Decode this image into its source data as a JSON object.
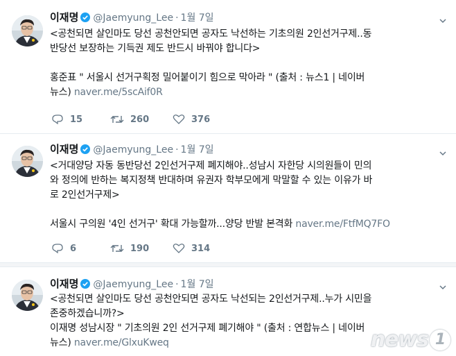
{
  "tweets": [
    {
      "name": "이재명",
      "handle": "@Jaemyung_Lee",
      "separator": "·",
      "date": "1월 7일",
      "lines": [
        "<공천되면 살인마도 당선 공천안되면 공자도 낙선하는 기초의원 2인선거구제..동",
        "반당선 보장하는 기득권 제도 반드시 바꿔야 합니다>"
      ],
      "quote_line1": "홍준표  \" 서울시 선거구획정 밀어붙이기 힘으로 막아라 \"  (출처 : 뉴스1 | 네이버",
      "quote_line2_text": "뉴스) ",
      "quote_link": "naver.me/5scAif0R",
      "replies": "15",
      "retweets": "260",
      "likes": "376"
    },
    {
      "name": "이재명",
      "handle": "@Jaemyung_Lee",
      "separator": "·",
      "date": "1월 7일",
      "lines": [
        "<거대양당 자동 동반당선 2인선거구제 폐지해야..성남시 자한당 시의원들이 민의",
        "와 정의에 반하는 복지정책 반대하며 유권자 학부모에게 막말할 수 있는 이유가 바",
        "로 2인선거구제>"
      ],
      "quote_text": "서울시 구의원 '4인 선거구' 확대 가능할까...양당 반발 본격화  ",
      "quote_link": "naver.me/FtfMQ7FO",
      "replies": "6",
      "retweets": "190",
      "likes": "314"
    },
    {
      "name": "이재명",
      "handle": "@Jaemyung_Lee",
      "separator": "·",
      "date": "1월 7일",
      "lines": [
        "<공천되면 살인마도 당선 공천안되면 공자도 낙선되는 2인선거구제..누가 시민을",
        "존중하겠습니까?>",
        "이재명 성남시장  \" 기초의원 2인 선거구제 폐기해야 \"  (출처 : 연합뉴스 | 네이버"
      ],
      "quote_line2_text": "뉴스) ",
      "quote_link": "naver.me/GlxuKweq"
    }
  ],
  "watermark": {
    "text": "news",
    "badge": "1"
  },
  "colors": {
    "text": "#14171a",
    "secondary": "#657786",
    "verified": "#1da1f2",
    "divider": "#e6ecf0"
  }
}
